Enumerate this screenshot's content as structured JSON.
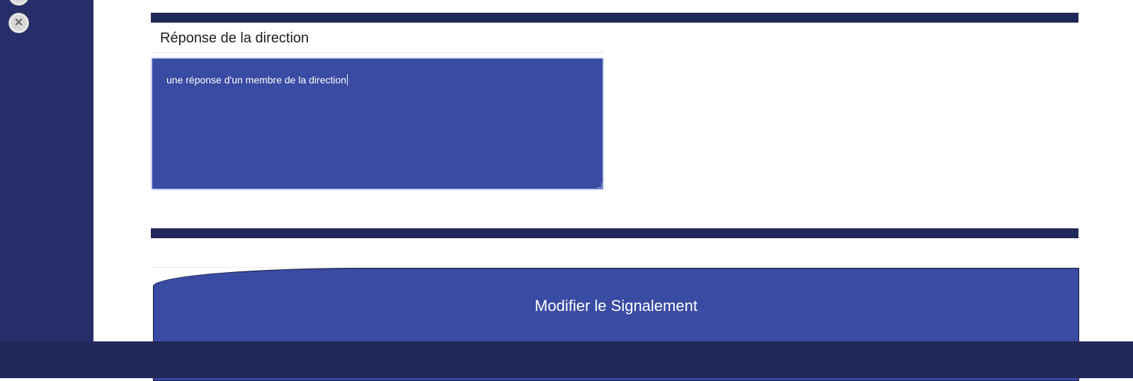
{
  "sidebar": {
    "close_icon": "close-icon"
  },
  "form": {
    "section_title": "Réponse de la direction",
    "response_value": "une réponse d'un membre de la direction",
    "submit_label": "Modifier le Signalement"
  },
  "colors": {
    "sidebar": "#262d68",
    "accent": "#394ba3",
    "divider": "#20285a",
    "footer": "#20285a"
  }
}
